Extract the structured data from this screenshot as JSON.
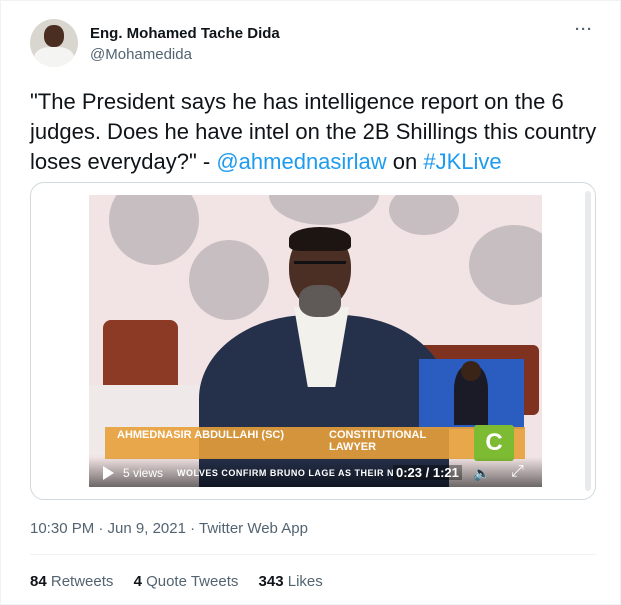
{
  "author": {
    "name": "Eng. Mohamed Tache Dida",
    "handle": "@Mohamedida"
  },
  "menu_icon": "more-horizontal-icon",
  "tweet": {
    "text_before": "\"The President says he has intelligence report on the 6 judges. Does he have intel on the 2B Shillings this country loses everyday?\" - ",
    "mention": "@ahmednasirlaw",
    "text_middle": " on ",
    "hashtag": "#JKLive"
  },
  "video": {
    "lower_third_name": "AHMEDNASIR ABDULLAHI (SC)",
    "lower_third_title": "CONSTITUTIONAL LAWYER",
    "channel_logo": "C",
    "view_count": "5 views",
    "ticker_text": "WOLVES CONFIRM BRUNO LAGE AS THEIR N",
    "time": "0:23 / 1:21",
    "icons": [
      "play-icon",
      "volume-icon",
      "expand-icon"
    ]
  },
  "timestamp": "10:30 PM · Jun 9, 2021 · Twitter Web App",
  "stats": {
    "retweets_count": "84",
    "retweets_label": "Retweets",
    "quotes_count": "4",
    "quotes_label": "Quote Tweets",
    "likes_count": "343",
    "likes_label": "Likes"
  },
  "colors": {
    "link": "#1d9bf0",
    "secondary_text": "#536471",
    "primary_text": "#0f1419"
  }
}
